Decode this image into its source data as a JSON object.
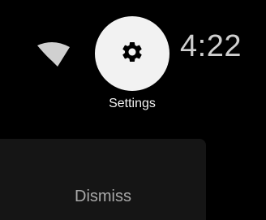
{
  "status_bar": {
    "wifi_icon": "wifi-icon",
    "time": "4:22"
  },
  "settings_tile": {
    "icon": "gear-icon",
    "label": "Settings"
  },
  "dismiss_card": {
    "label": "Dismiss"
  },
  "colors": {
    "background": "#000000",
    "tile_background": "#f2f2f2",
    "card_background": "#151515",
    "time_text": "#cfcfcf",
    "dismiss_text": "#a8a8a8"
  }
}
